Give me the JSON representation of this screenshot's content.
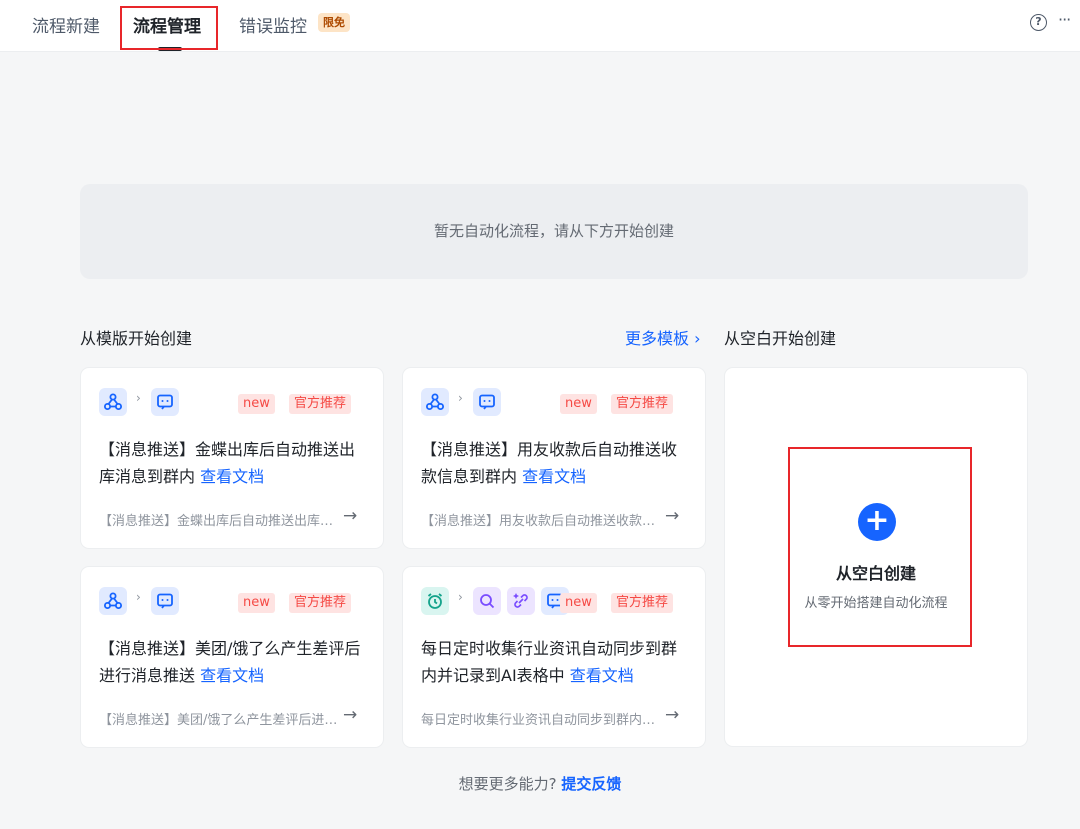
{
  "tabs": [
    {
      "label": "流程新建"
    },
    {
      "label": "流程管理"
    },
    {
      "label": "错误监控",
      "badge": "限免"
    }
  ],
  "top_actions": {
    "help_icon": "help-circle-icon",
    "more_icon": "more-horizontal-icon",
    "help_glyph": "?",
    "more_glyph": "···"
  },
  "empty_state": "暂无自动化流程，请从下方开始创建",
  "templates_section": {
    "title": "从模版开始创建",
    "more_label": "更多模板",
    "more_chevron": "›"
  },
  "blank_section": {
    "title": "从空白开始创建",
    "button_title": "从空白创建",
    "button_subtitle": "从零开始搭建自动化流程",
    "plus_glyph": "+"
  },
  "cards": [
    {
      "title": "【消息推送】金蝶出库后自动推送出库消息到群内",
      "doc_link": "查看文档",
      "description": "【消息推送】金蝶出库后自动推送出库消息到群内",
      "tag_new": "new",
      "tag_recommend": "官方推荐"
    },
    {
      "title": "【消息推送】用友收款后自动推送收款信息到群内",
      "doc_link": "查看文档",
      "description": "【消息推送】用友收款后自动推送收款信息到群内",
      "tag_new": "new",
      "tag_recommend": "官方推荐"
    },
    {
      "title": "【消息推送】美团/饿了么产生差评后进行消息推送",
      "doc_link": "查看文档",
      "description": "【消息推送】美团/饿了么产生差评后进行消息推送",
      "tag_new": "new",
      "tag_recommend": "官方推荐"
    },
    {
      "title": "每日定时收集行业资讯自动同步到群内并记录到AI表格中",
      "doc_link": "查看文档",
      "description": "每日定时收集行业资讯自动同步到群内并记录到AI表格中",
      "tag_new": "new",
      "tag_recommend": "官方推荐"
    }
  ],
  "icons": {
    "chevron": "›",
    "arrow": "→"
  },
  "feedback": {
    "prefix": "想要更多能力?",
    "link": "提交反馈"
  },
  "colors": {
    "accent": "#1664ff",
    "tag_red": "#f54a45",
    "highlight": "#e8262a"
  }
}
